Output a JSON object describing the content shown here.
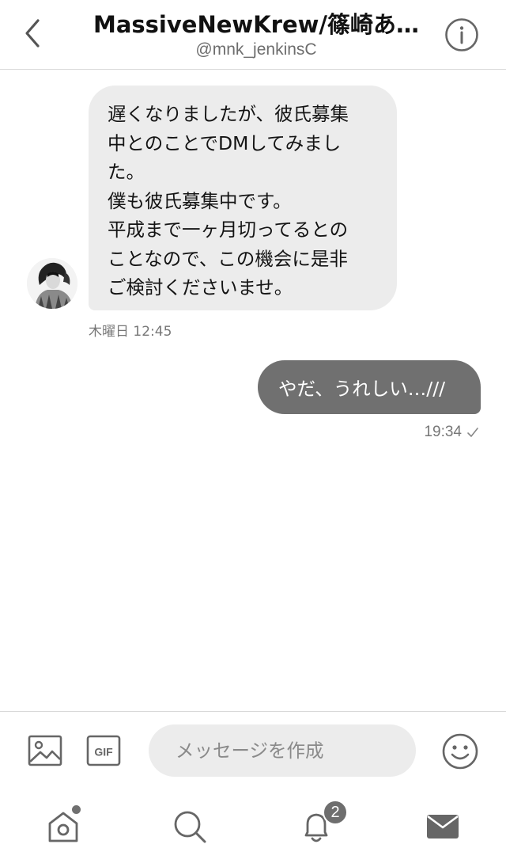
{
  "header": {
    "title": "MassiveNewKrew/篠崎あ…",
    "handle": "@mnk_jenkinsC"
  },
  "messages": [
    {
      "direction": "incoming",
      "text": "遅くなりましたが、彼氏募集\n中とのことでDMしてみまし\nた。\n僕も彼氏募集中です。\n平成まで一ヶ月切ってるとの\nことなので、この機会に是非\nご検討くださいませ。",
      "time": "木曜日 12:45"
    },
    {
      "direction": "outgoing",
      "text": "やだ、うれしい…///",
      "time": "19:34",
      "status_icon": "check-icon"
    }
  ],
  "composer": {
    "placeholder": "メッセージを作成",
    "gif_label": "GIF"
  },
  "tabbar": {
    "notification_count": "2"
  },
  "colors": {
    "incoming_bubble": "#ececec",
    "outgoing_bubble": "#707070",
    "secondary_text": "#777777"
  }
}
